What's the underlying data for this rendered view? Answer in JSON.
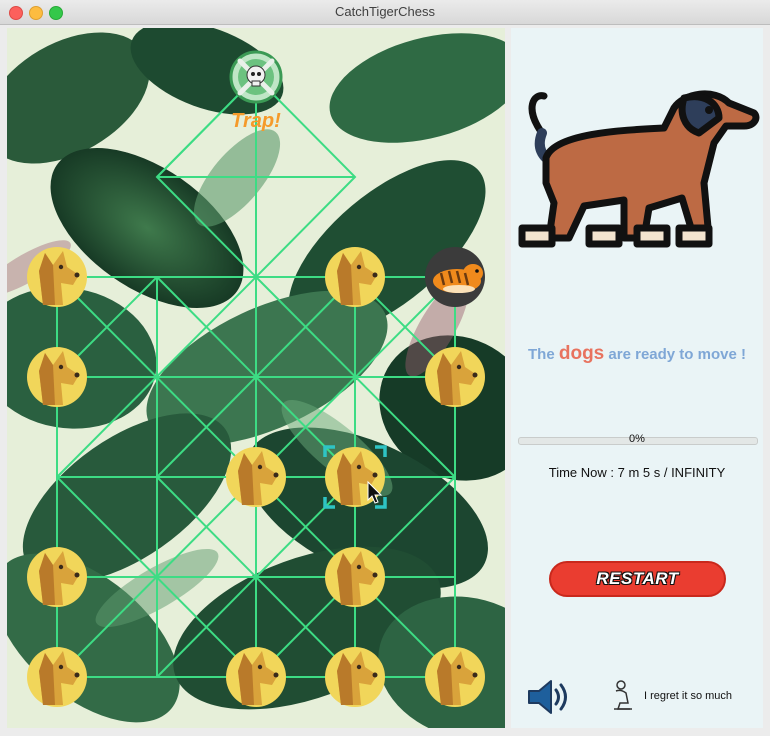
{
  "window": {
    "title": "CatchTigerChess"
  },
  "board": {
    "trap_label": "Trap!",
    "line_color": "#3ddc84",
    "dogs": [
      [
        0,
        1
      ],
      [
        3,
        1
      ],
      [
        0,
        2
      ],
      [
        4,
        2
      ],
      [
        2,
        3
      ],
      [
        3,
        3
      ],
      [
        0,
        4
      ],
      [
        3,
        4
      ],
      [
        0,
        5
      ],
      [
        2,
        5
      ],
      [
        3,
        5
      ],
      [
        4,
        5
      ]
    ],
    "tiger": [
      4,
      1
    ],
    "selected": [
      3,
      3
    ]
  },
  "panel": {
    "status_prefix": "The",
    "status_highlight": "dogs",
    "status_suffix": "are ready to move !",
    "progress_value": 0,
    "progress_text": "0%",
    "time_text": "Time Now : 7 m 5 s / INFINITY",
    "restart_label": "RESTART",
    "regret_label": "I regret it so much"
  },
  "colors": {
    "accent": "#ea3d30",
    "status_blue": "#7fa7d6",
    "status_orange": "#e8735f",
    "selection": "#2ec4c4"
  }
}
